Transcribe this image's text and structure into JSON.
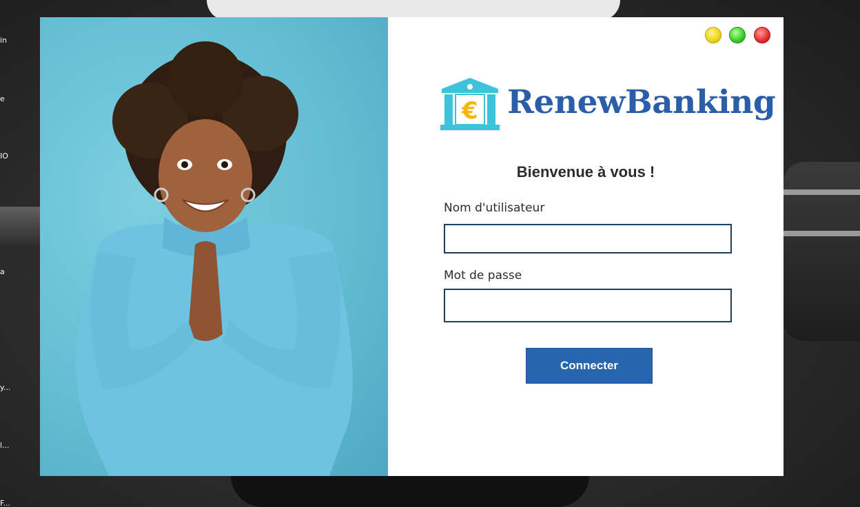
{
  "desktop": {
    "labels": [
      "in",
      "e",
      "IO",
      "a",
      "y...",
      "l...",
      "F..."
    ]
  },
  "window": {
    "controls": {
      "minimize_icon": "minimize-icon",
      "maximize_icon": "maximize-icon",
      "close_icon": "close-icon"
    },
    "brand": {
      "name": "RenewBanking",
      "logo_icon": "bank-euro-icon",
      "color": "#2a5ea8"
    },
    "welcome": "Bienvenue à vous !",
    "form": {
      "username_label": "Nom d'utilisateur",
      "username_value": "",
      "password_label": "Mot de passe",
      "password_value": "",
      "submit_label": "Connecter"
    },
    "colors": {
      "accent": "#2766ae",
      "photo_bg": "#63bdd3",
      "input_border": "#1d3e5c"
    }
  }
}
